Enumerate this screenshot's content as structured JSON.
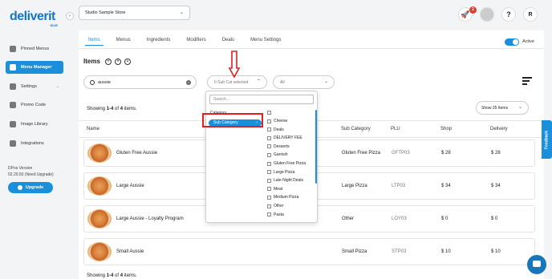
{
  "brand": {
    "name": "deliverit",
    "sub": "iDUE"
  },
  "store": {
    "selected": "Studio Sample Store"
  },
  "header": {
    "notification_count": "2",
    "help": "?",
    "user_initial": "R"
  },
  "sidebar": {
    "items": [
      {
        "label": "Pinned Menus",
        "icon": "pin-icon"
      },
      {
        "label": "Menu Manager",
        "icon": "menu-icon",
        "active": true
      },
      {
        "label": "Settings",
        "icon": "gear-icon"
      },
      {
        "label": "Promo Code",
        "icon": "ticket-icon"
      },
      {
        "label": "Image Library",
        "icon": "image-icon"
      },
      {
        "label": "Integrations",
        "icon": "plug-icon"
      }
    ],
    "version_title": "DPos Version",
    "version_value": "02.20.50 (Need Upgrade)",
    "upgrade_label": "Upgrade"
  },
  "tabs": [
    "Items",
    "Menus",
    "Ingredients",
    "Modifiers",
    "Deals",
    "Menu Settings"
  ],
  "active_toggle_label": "Active",
  "items_title": "Items",
  "search": {
    "value": "aussie",
    "placeholder": "Search"
  },
  "filters": {
    "subcat_placeholder": "0 Sub Cat selected",
    "all_label": "All"
  },
  "showing": {
    "prefix": "Showing ",
    "range": "1-4",
    "of": " of ",
    "total": "4",
    "suffix": " items."
  },
  "page_size": "Show 25 Items",
  "table": {
    "headers": [
      "Name",
      "Sub Category",
      "PLU",
      "Shop",
      "Delivery"
    ],
    "rows": [
      {
        "name": "Gluten Free Aussie",
        "sub": "Gluten Free Pizza",
        "plu": "GFTP03",
        "shop": "$ 28",
        "delivery": "$ 28"
      },
      {
        "name": "Large Aussie",
        "sub": "Large Pizza",
        "plu": "LTP03",
        "shop": "$ 34",
        "delivery": "$ 34"
      },
      {
        "name": "Large Aussie - Loyalty Program",
        "sub": "Other",
        "plu": "LOY03",
        "shop": "$ 0",
        "delivery": "$ 0"
      },
      {
        "name": "Small Aussie",
        "sub": "Small Pizza",
        "plu": "STP03",
        "shop": "$ 10",
        "delivery": "$ 10"
      }
    ]
  },
  "dropdown": {
    "search_placeholder": "Search...",
    "categories": [
      "Category",
      "Sub Category"
    ],
    "options": [
      "Cheese",
      "Deals",
      "DELIVERY FEE",
      "Desserts",
      "Garnish",
      "Gluten Free Pizza",
      "Large Pizza",
      "Late Night Deals",
      "Meat",
      "Medium Pizza",
      "Other",
      "Pasta"
    ]
  },
  "feedback_label": "Feedback",
  "colors": {
    "accent": "#1a8fdb",
    "annotation": "#e02020"
  }
}
